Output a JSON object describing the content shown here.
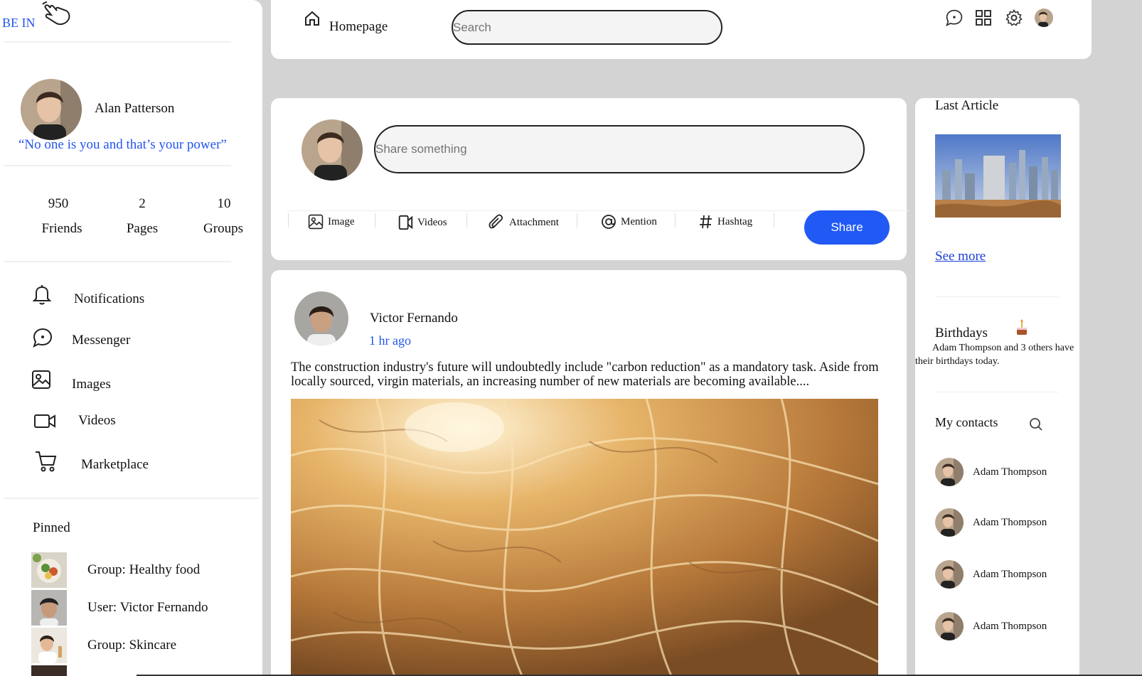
{
  "brand": {
    "name": "BE IN"
  },
  "profile": {
    "name": "Alan Patterson",
    "quote": "“No one is you and that’s your power”",
    "stats": [
      {
        "value": "950",
        "label": "Friends"
      },
      {
        "value": "2",
        "label": "Pages"
      },
      {
        "value": "10",
        "label": "Groups"
      }
    ]
  },
  "nav": {
    "items": [
      {
        "label": "Notifications",
        "icon": "bell-icon"
      },
      {
        "label": "Messenger",
        "icon": "chat-icon"
      },
      {
        "label": "Images",
        "icon": "image-icon"
      },
      {
        "label": "Videos",
        "icon": "video-icon"
      },
      {
        "label": "Marketplace",
        "icon": "cart-icon"
      }
    ]
  },
  "pinned": {
    "title": "Pinned",
    "items": [
      {
        "prefix": "Group: ",
        "name": "Healthy food"
      },
      {
        "prefix": "User: ",
        "name": "Victor Fernando"
      },
      {
        "prefix": "Group: ",
        "name": "Skincare"
      }
    ]
  },
  "topbar": {
    "home_label": "Homepage",
    "search_placeholder": "Search"
  },
  "composer": {
    "placeholder": "Share something",
    "actions": [
      {
        "label": "Image",
        "icon": "image-icon"
      },
      {
        "label": "Videos",
        "icon": "video-icon"
      },
      {
        "label": "Attachment",
        "icon": "paperclip-icon"
      },
      {
        "label": "Mention",
        "icon": "at-icon"
      },
      {
        "label": "Hashtag",
        "icon": "hashtag-icon"
      }
    ],
    "share_label": "Share"
  },
  "post": {
    "author": "Victor Fernando",
    "time": "1 hr ago",
    "text": "The construction industry's future will undoubtedly include \"carbon reduction\" as a mandatory task. Aside from locally sourced, virgin materials, an increasing number of new materials are becoming available...."
  },
  "right": {
    "last_article_title": "Last Article",
    "see_more": "See more",
    "birthdays_title": "Birthdays",
    "birthdays_text": "Adam Thompson and 3 others have their birthdays today.",
    "contacts_title": "My contacts",
    "contacts": [
      {
        "name": "Adam Thompson"
      },
      {
        "name": "Adam Thompson"
      },
      {
        "name": "Adam Thompson"
      },
      {
        "name": "Adam Thompson"
      }
    ]
  },
  "colors": {
    "accent": "#2159f5",
    "link": "#2255ee",
    "background": "#d3d3d3"
  }
}
